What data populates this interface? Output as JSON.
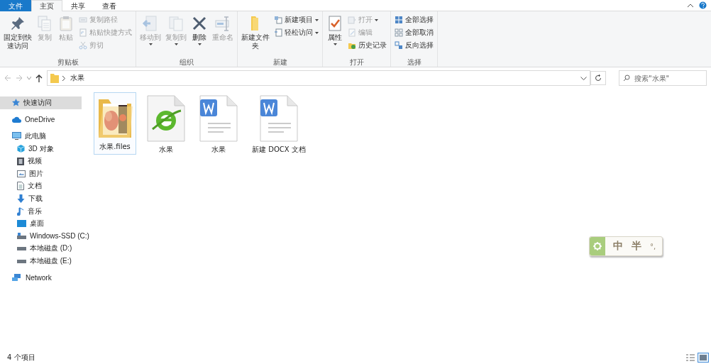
{
  "ribbon": {
    "tabs": [
      {
        "label": "文件",
        "kind": "menu",
        "selected": false
      },
      {
        "label": "主页",
        "kind": "tab",
        "selected": true
      },
      {
        "label": "共享",
        "kind": "tab",
        "selected": false
      },
      {
        "label": "查看",
        "kind": "tab",
        "selected": false
      }
    ],
    "groups": [
      {
        "label": "剪贴板",
        "items": [
          {
            "label": "固定到快速访问",
            "kind": "large",
            "disabled": false
          },
          {
            "label": "复制",
            "kind": "large",
            "disabled": true
          },
          {
            "label": "粘贴",
            "kind": "large",
            "disabled": true
          },
          {
            "label": "复制路径",
            "kind": "small",
            "disabled": true
          },
          {
            "label": "粘贴快捷方式",
            "kind": "small",
            "disabled": true
          },
          {
            "label": "剪切",
            "kind": "small",
            "disabled": true
          }
        ]
      },
      {
        "label": "组织",
        "items": [
          {
            "label": "移动到",
            "kind": "large",
            "disabled": true,
            "dropdown": true
          },
          {
            "label": "复制到",
            "kind": "large",
            "disabled": true,
            "dropdown": true
          },
          {
            "label": "删除",
            "kind": "large",
            "disabled": false,
            "dropdown": true
          },
          {
            "label": "重命名",
            "kind": "large",
            "disabled": true
          }
        ]
      },
      {
        "label": "新建",
        "items": [
          {
            "label": "新建文件夹",
            "kind": "large",
            "disabled": false
          },
          {
            "label": "新建项目",
            "kind": "small",
            "disabled": false,
            "dropdown": true
          },
          {
            "label": "轻松访问",
            "kind": "small",
            "disabled": false,
            "dropdown": true
          }
        ]
      },
      {
        "label": "打开",
        "items": [
          {
            "label": "属性",
            "kind": "large",
            "disabled": false,
            "dropdown": true
          },
          {
            "label": "打开",
            "kind": "small",
            "disabled": true,
            "dropdown": true
          },
          {
            "label": "编辑",
            "kind": "small",
            "disabled": true
          },
          {
            "label": "历史记录",
            "kind": "small",
            "disabled": false
          }
        ]
      },
      {
        "label": "选择",
        "items": [
          {
            "label": "全部选择",
            "kind": "small",
            "disabled": false
          },
          {
            "label": "全部取消",
            "kind": "small",
            "disabled": false
          },
          {
            "label": "反向选择",
            "kind": "small",
            "disabled": false
          }
        ]
      }
    ]
  },
  "address_bar": {
    "path": [
      "水果"
    ]
  },
  "search": {
    "placeholder": "搜索\"水果\""
  },
  "sidebar": {
    "items": [
      {
        "label": "快速访问",
        "selected": true
      },
      {
        "label": "OneDrive",
        "selected": false
      },
      {
        "label": "此电脑",
        "selected": false,
        "children": [
          {
            "label": "3D 对象",
            "selected": false
          },
          {
            "label": "视频",
            "selected": false
          },
          {
            "label": "图片",
            "selected": false
          },
          {
            "label": "文档",
            "selected": false
          },
          {
            "label": "下载",
            "selected": false
          },
          {
            "label": "音乐",
            "selected": false
          },
          {
            "label": "桌面",
            "selected": false
          },
          {
            "label": "Windows-SSD (C:)",
            "selected": false
          },
          {
            "label": "本地磁盘 (D:)",
            "selected": false
          },
          {
            "label": "本地磁盘 (E:)",
            "selected": false
          }
        ]
      },
      {
        "label": "Network",
        "selected": false
      }
    ]
  },
  "files": [
    {
      "name": "水果.files",
      "kind": "folder",
      "selected": true
    },
    {
      "name": "水果",
      "kind": "web",
      "selected": false
    },
    {
      "name": "水果",
      "kind": "word",
      "selected": false
    },
    {
      "name": "新建 DOCX 文档",
      "kind": "word",
      "selected": false
    }
  ],
  "ime_toolbar": {
    "items": [
      "中",
      "半",
      "°,"
    ]
  },
  "status_bar": {
    "text": "4 个项目",
    "view_buttons": [
      {
        "selected": false
      },
      {
        "selected": true
      }
    ]
  }
}
